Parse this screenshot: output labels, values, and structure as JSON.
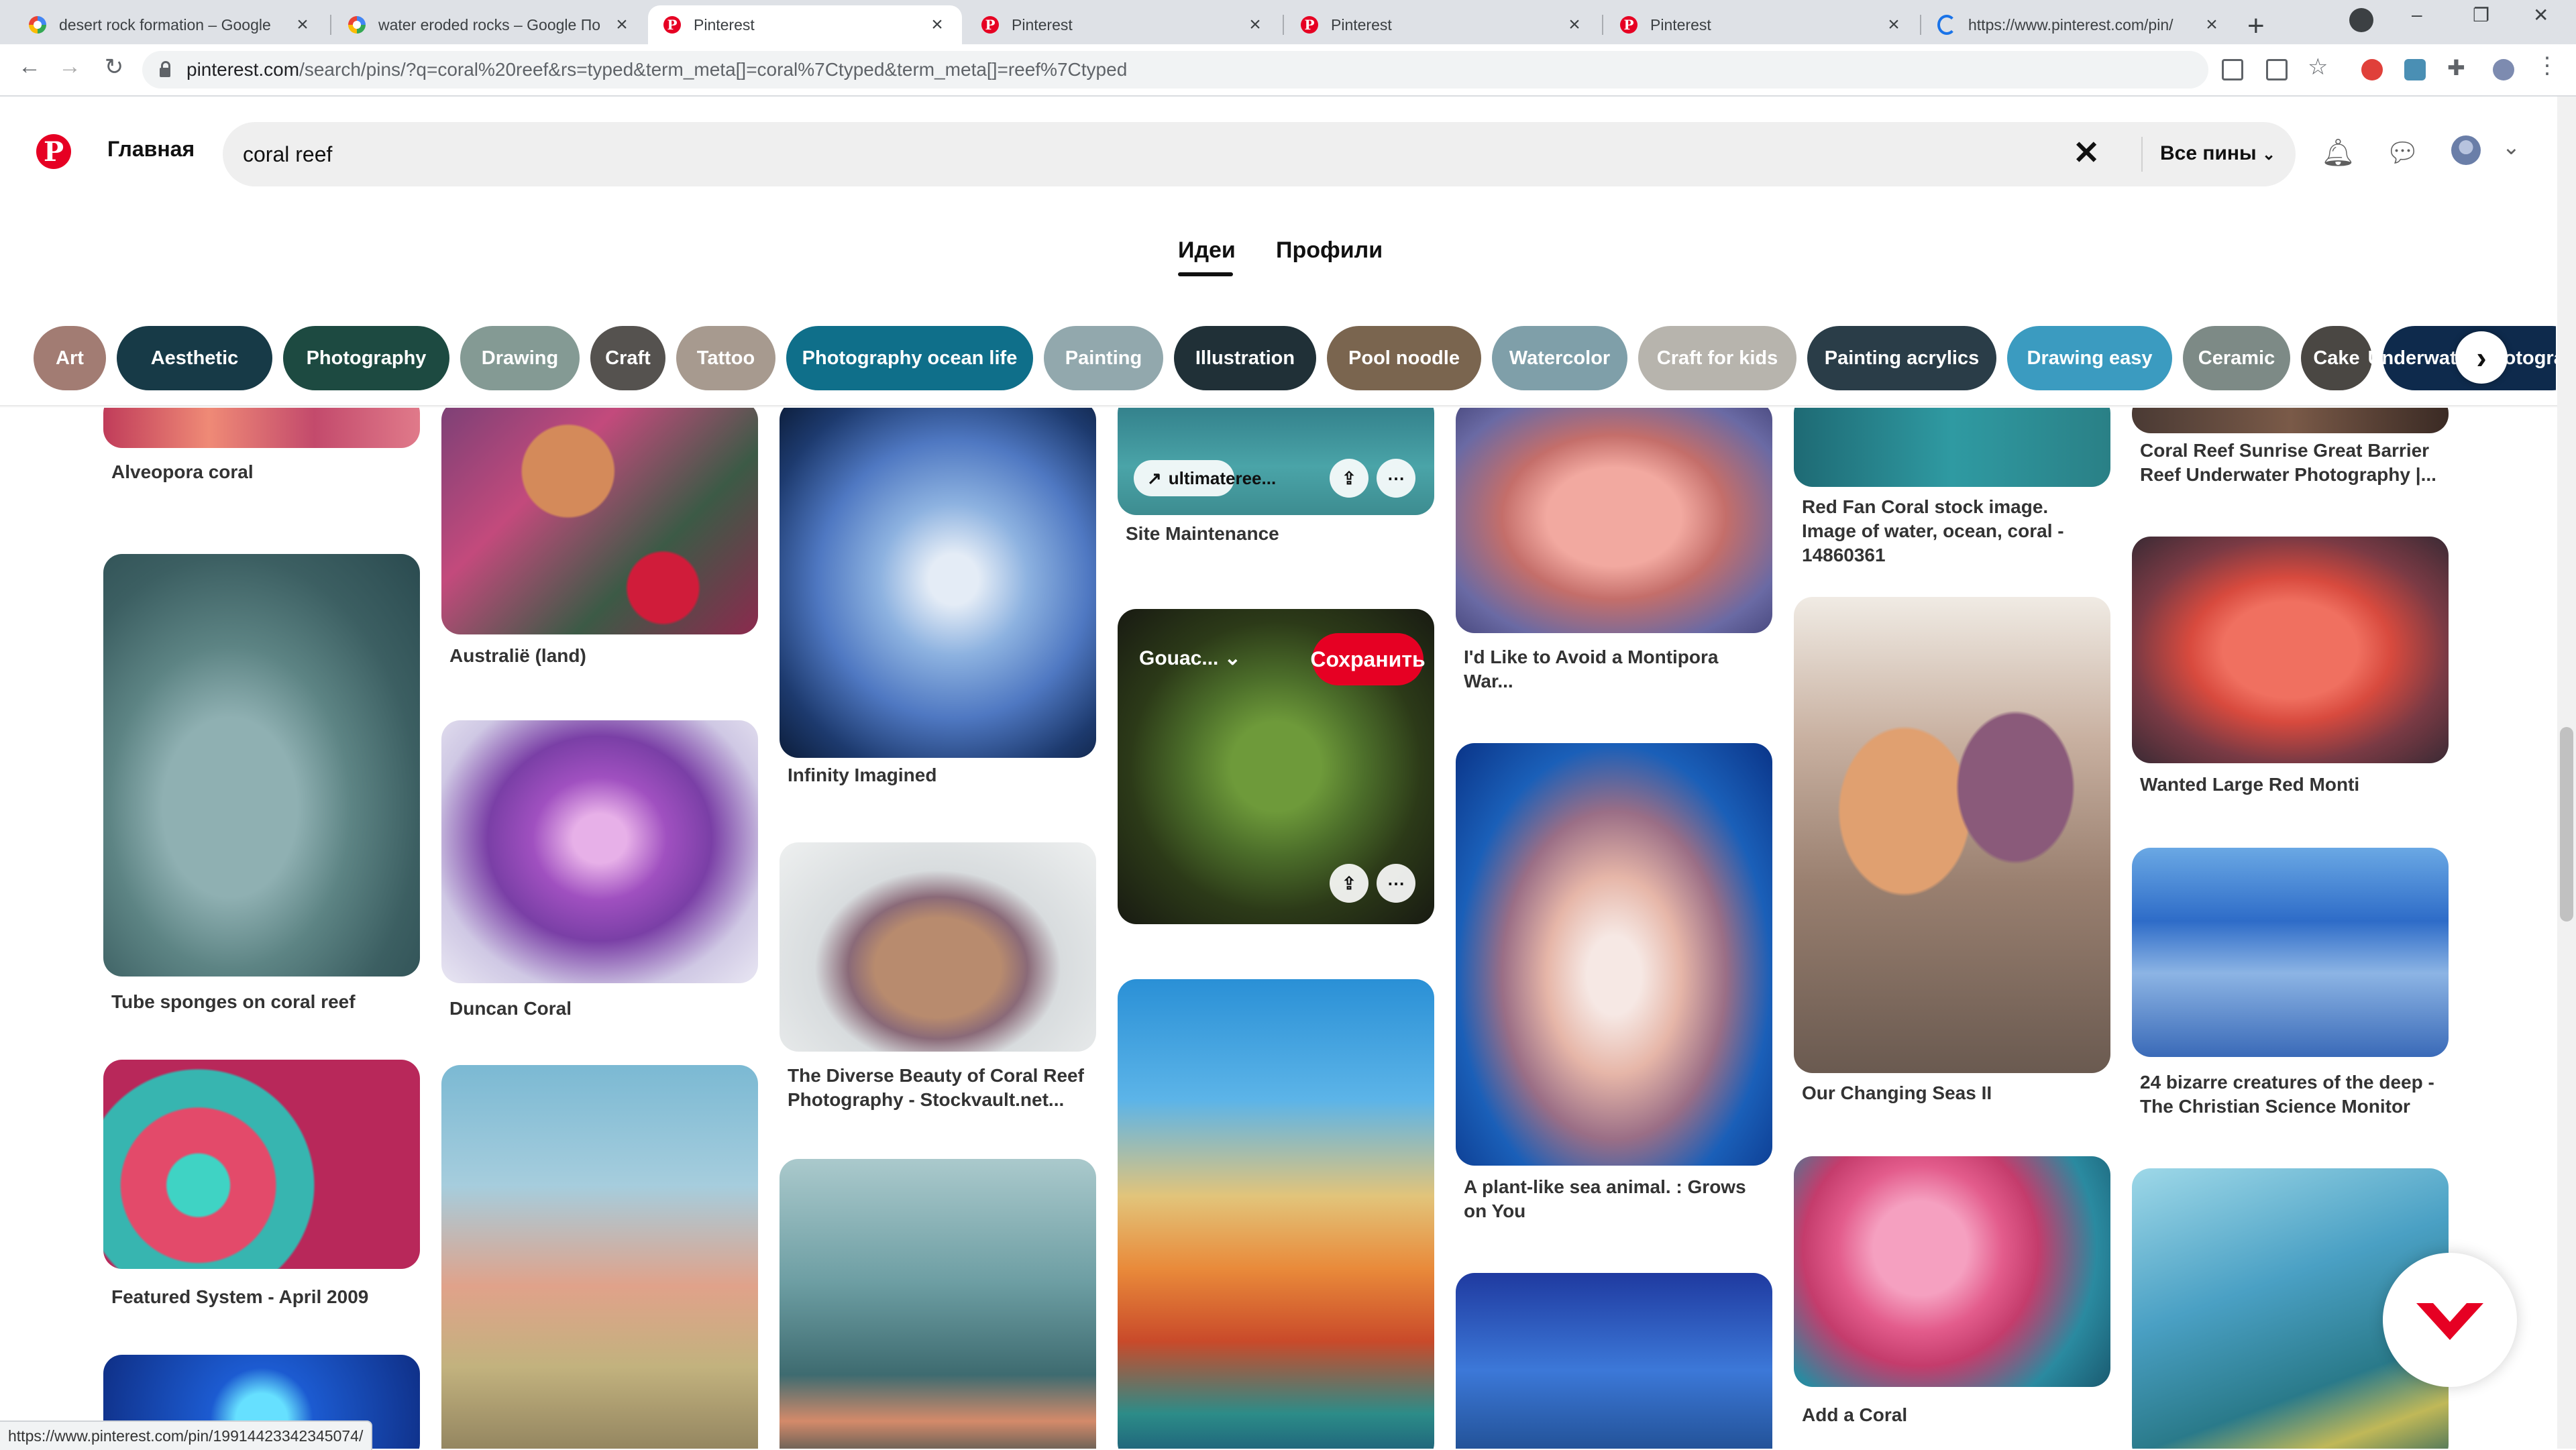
{
  "browser": {
    "tabs": [
      {
        "title": "desert rock formation – Google",
        "favicon": "google-icon"
      },
      {
        "title": "water eroded rocks – Google По",
        "favicon": "google-icon"
      },
      {
        "title": "Pinterest",
        "favicon": "pinterest-icon"
      },
      {
        "title": "Pinterest",
        "favicon": "pinterest-icon"
      },
      {
        "title": "Pinterest",
        "favicon": "pinterest-icon"
      },
      {
        "title": "Pinterest",
        "favicon": "pinterest-icon"
      },
      {
        "title": "https://www.pinterest.com/pin/",
        "favicon": "loading-icon"
      }
    ],
    "url_host": "pinterest.com",
    "url_path": "/search/pins/?q=coral%20reef&rs=typed&term_meta[]=coral%7Ctyped&term_meta[]=reef%7Ctyped",
    "status_url": "https://www.pinterest.com/pin/199144233423450​74/"
  },
  "header": {
    "home_label": "Главная",
    "search_value": "coral reef",
    "scope_label": "Все пины"
  },
  "search_tabs": {
    "ideas": "Идеи",
    "profiles": "Профили"
  },
  "chips": [
    {
      "label": "Art",
      "color": "#a27c73"
    },
    {
      "label": "Aesthetic",
      "color": "#173a47"
    },
    {
      "label": "Photography",
      "color": "#1d4a41"
    },
    {
      "label": "Drawing",
      "color": "#849a94"
    },
    {
      "label": "Craft",
      "color": "#55524f"
    },
    {
      "label": "Tattoo",
      "color": "#a79a8f"
    },
    {
      "label": "Photography ocean life",
      "color": "#0f6f8a"
    },
    {
      "label": "Painting",
      "color": "#92a8ad"
    },
    {
      "label": "Illustration",
      "color": "#203037"
    },
    {
      "label": "Pool noodle",
      "color": "#7a654f"
    },
    {
      "label": "Watercolor",
      "color": "#7f9fa9"
    },
    {
      "label": "Craft for kids",
      "color": "#b7b4ad"
    },
    {
      "label": "Painting acrylics",
      "color": "#2a3d48"
    },
    {
      "label": "Drawing easy",
      "color": "#3b9bc0"
    },
    {
      "label": "Ceramic",
      "color": "#7d8a86"
    },
    {
      "label": "Cake",
      "color": "#4a4743"
    },
    {
      "label": "Underwater photography",
      "color": "#0e2a4c"
    }
  ],
  "pins": {
    "c1": [
      {
        "caption": "Alveopora coral"
      },
      {
        "caption": "Tube sponges on coral reef"
      },
      {
        "caption": "Featured System - April 2009"
      },
      {
        "caption": ""
      }
    ],
    "c2": [
      {
        "caption": "Australië (land)"
      },
      {
        "caption": "Duncan Coral"
      },
      {
        "caption": ""
      }
    ],
    "c3": [
      {
        "caption": "Infinity Imagined"
      },
      {
        "caption": "The Diverse Beauty of Coral Reef Photography - Stockvault.net..."
      },
      {
        "caption": ""
      }
    ],
    "c4": [
      {
        "caption": "Site Maintenance",
        "source": "ultimateree..."
      },
      {
        "caption": "",
        "board": "Gouac...",
        "save": "Сохранить"
      },
      {
        "caption": ""
      }
    ],
    "c5": [
      {
        "caption": "I'd Like to Avoid a Montipora War..."
      },
      {
        "caption": "A plant-like sea animal. : Grows on You"
      },
      {
        "caption": ""
      }
    ],
    "c6": [
      {
        "caption": "Red Fan Coral stock image. Image of water, ocean, coral - 14860361"
      },
      {
        "caption": "Our Changing Seas II"
      },
      {
        "caption": "Add a Coral"
      }
    ],
    "c7": [
      {
        "caption": "Coral Reef Sunrise Great Barrier Reef Underwater Photography |..."
      },
      {
        "caption": "Wanted Large Red Monti"
      },
      {
        "caption": "24 bizarre creatures of the deep - The Christian Science Monitor"
      },
      {
        "caption": ""
      }
    ]
  }
}
